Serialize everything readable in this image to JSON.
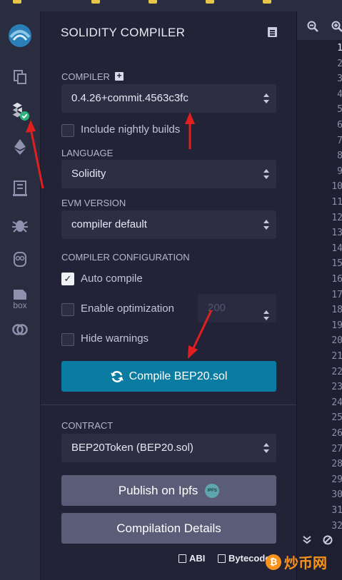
{
  "panel": {
    "title": "SOLIDITY COMPILER"
  },
  "compiler": {
    "label": "COMPILER",
    "version": "0.4.26+commit.4563c3fc",
    "nightly_label": "Include nightly builds"
  },
  "language": {
    "label": "LANGUAGE",
    "value": "Solidity"
  },
  "evm": {
    "label": "EVM VERSION",
    "value": "compiler default"
  },
  "config": {
    "label": "COMPILER CONFIGURATION",
    "auto_compile_label": "Auto compile",
    "auto_compile_checked": true,
    "optimization_label": "Enable optimization",
    "optimization_runs": "200",
    "hide_warnings_label": "Hide warnings"
  },
  "compile_button": {
    "label": "Compile BEP20.sol"
  },
  "contract": {
    "label": "CONTRACT",
    "value": "BEP20Token (BEP20.sol)"
  },
  "publish_button": {
    "label": "Publish on Ipfs",
    "badge": "IPFS"
  },
  "details_button": {
    "label": "Compilation Details"
  },
  "bottom_links": {
    "abi": "ABI",
    "bytecode": "Bytecode"
  },
  "sidebar": {
    "box_label": "box"
  },
  "editor": {
    "line_numbers": [
      "1",
      "2",
      "3",
      "4",
      "5",
      "6",
      "7",
      "8",
      "9",
      "10",
      "11",
      "12",
      "13",
      "14",
      "15",
      "16",
      "17",
      "18",
      "19",
      "20",
      "21",
      "22",
      "23",
      "24",
      "25",
      "26",
      "27",
      "28",
      "29",
      "30",
      "31",
      "32"
    ],
    "active_line": "1"
  },
  "watermark": {
    "text": "炒币网"
  },
  "colors": {
    "accent": "#0a7ca1",
    "panel_bg": "#222336",
    "sidebar_bg": "#2a2c3f",
    "success": "#2fb37a",
    "annotation_arrow": "#e02020",
    "watermark": "#f7931a"
  }
}
